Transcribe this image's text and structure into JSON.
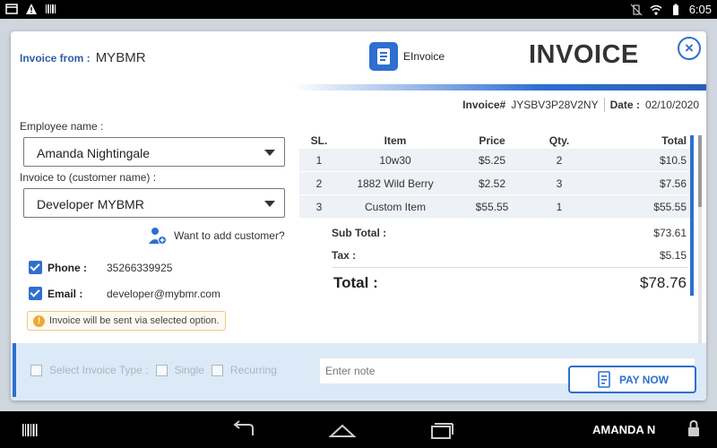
{
  "status": {
    "time": "6:05"
  },
  "invoice_from": {
    "label": "Invoice from :",
    "value": "MYBMR"
  },
  "logo": {
    "text": "EInvoice"
  },
  "title": "INVOICE",
  "meta": {
    "invoice_label": "Invoice#",
    "invoice_no": "JYSBV3P28V2NY",
    "date_label": "Date :",
    "date": "02/10/2020"
  },
  "employee": {
    "label": "Employee name :",
    "value": "Amanda Nightingale"
  },
  "customer": {
    "label": "Invoice to (customer name) :",
    "value": "Developer MYBMR"
  },
  "add_customer": "Want to add customer?",
  "phone": {
    "label": "Phone :",
    "value": "35266339925"
  },
  "email": {
    "label": "Email :",
    "value": "developer@mybmr.com"
  },
  "info_note": "Invoice will be sent via selected option.",
  "items": {
    "headers": [
      "SL.",
      "Item",
      "Price",
      "Qty.",
      "Total"
    ],
    "rows": [
      {
        "sl": "1",
        "item": "10w30",
        "price": "$5.25",
        "qty": "2",
        "total": "$10.5"
      },
      {
        "sl": "2",
        "item": "1882 Wild Berry",
        "price": "$2.52",
        "qty": "3",
        "total": "$7.56"
      },
      {
        "sl": "3",
        "item": "Custom Item",
        "price": "$55.55",
        "qty": "1",
        "total": "$55.55"
      }
    ]
  },
  "summary": {
    "subtotal_label": "Sub Total :",
    "subtotal": "$73.61",
    "tax_label": "Tax :",
    "tax": "$5.15",
    "total_label": "Total :",
    "total": "$78.76"
  },
  "bottom": {
    "select_type": "Select Invoice Type :",
    "single": "Single",
    "recurring": "Recurring",
    "note_placeholder": "Enter note",
    "pay": "PAY NOW"
  },
  "nav": {
    "user": "AMANDA N"
  },
  "colors": {
    "accent": "#2e6fd0",
    "label_blue": "#2f5ea8"
  }
}
